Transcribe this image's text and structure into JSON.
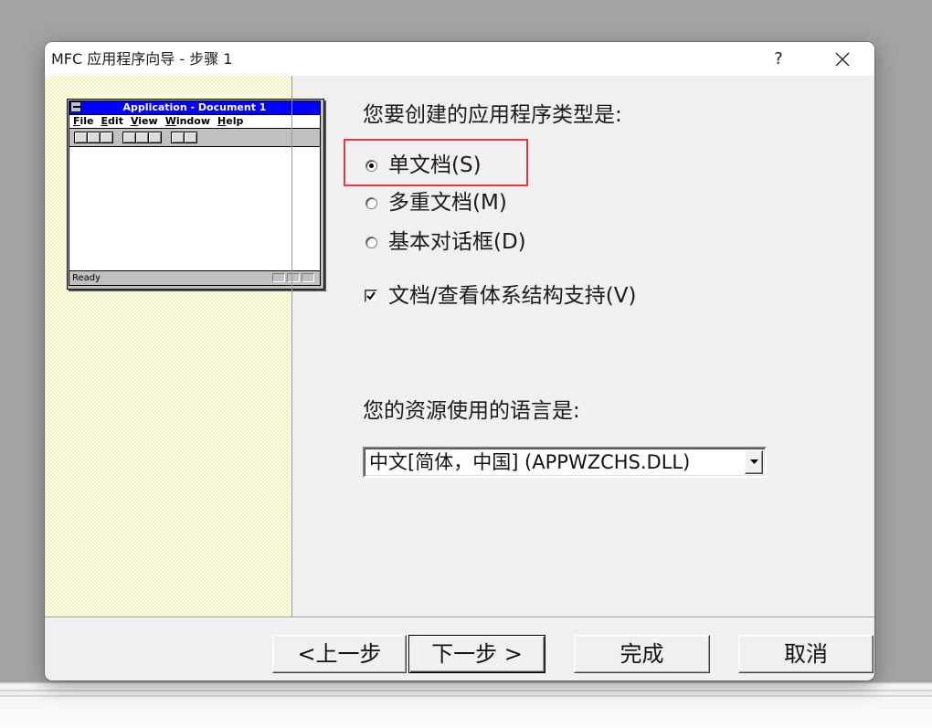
{
  "window": {
    "title": "MFC 应用程序向导 - 步骤 1",
    "help_label": "?"
  },
  "icons": {
    "close": "close-icon",
    "dropdown": "chevron-down-icon",
    "preview_system_menu": "system-menu-icon",
    "preview_toolbar_button": "toolbar-button-icon"
  },
  "preview": {
    "title": "Application - Document 1",
    "menu": [
      "File",
      "Edit",
      "View",
      "Window",
      "Help"
    ],
    "status": "Ready"
  },
  "app_type": {
    "prompt": "您要创建的应用程序类型是:",
    "options": [
      {
        "label": "单文档(S)",
        "checked": true
      },
      {
        "label": "多重文档(M)",
        "checked": false
      },
      {
        "label": "基本对话框(D)",
        "checked": false
      }
    ]
  },
  "doc_view": {
    "label": "文档/查看体系结构支持(V)",
    "checked": true
  },
  "language": {
    "prompt": "您的资源使用的语言是:",
    "selected": "中文[简体，中国] (APPWZCHS.DLL)"
  },
  "buttons": {
    "back": "<上一步",
    "next": "下一步 >",
    "finish": "完成",
    "cancel": "取消"
  },
  "colors": {
    "highlight_box": "#e0393e",
    "preview_title_bar": "#0000ff",
    "left_panel": "#faf9d4"
  }
}
